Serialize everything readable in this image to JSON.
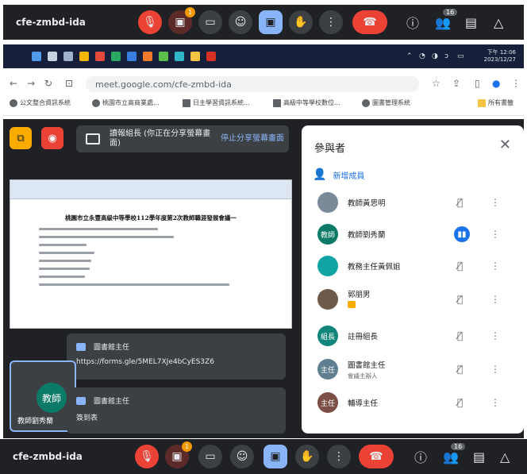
{
  "meeting": {
    "code": "cfe-zmbd-ida",
    "notification_count": "1",
    "people_count": "16"
  },
  "taskbar": {
    "clock_time": "下午 12:06",
    "clock_date": "2023/12/27"
  },
  "browser": {
    "url": "meet.google.com/cfe-zmbd-ida",
    "bookmarks": [
      "公文整合資訊系統",
      "桃園市立高商業處...",
      "日主學習資訊系統...",
      "高級中等學校數位...",
      "圖書管理系統"
    ],
    "all_bookmarks": "所有書籤"
  },
  "presenting": {
    "text": "讀報組長 (你正在分享螢幕畫面)",
    "stop_label": "停止分享螢幕畫面"
  },
  "document": {
    "title": "桃園市立永豐高級中等學校112學年度第2次教師職涯發展會議一"
  },
  "chat": [
    {
      "sender": "圖書館主任",
      "message": "https://forms.gle/5MEL7XJe4bCyES3Z6"
    },
    {
      "sender": "圖書館主任",
      "message": "簽到表"
    }
  ],
  "self_tile": {
    "avatar": "教師",
    "name": "教師劉秀蘭"
  },
  "panel": {
    "title": "參與者",
    "add_label": "新增成員",
    "participants": [
      {
        "avatar": "",
        "name": "教師黃思明",
        "sub": "",
        "color": "#7a8a99",
        "speaking": false,
        "hand": false
      },
      {
        "avatar": "教師",
        "name": "教師劉秀蘭",
        "sub": "",
        "color": "#0b7a67",
        "speaking": true,
        "hand": false
      },
      {
        "avatar": "",
        "name": "教務主任黃佩姐",
        "sub": "",
        "color": "#12a4a3",
        "speaking": false,
        "hand": false
      },
      {
        "avatar": "",
        "name": "郭朋男",
        "sub": "",
        "color": "#6e5a4a",
        "speaking": false,
        "hand": true
      },
      {
        "avatar": "組長",
        "name": "註冊組長",
        "sub": "",
        "color": "#12867a",
        "speaking": false,
        "hand": false
      },
      {
        "avatar": "主任",
        "name": "圖書館主任",
        "sub": "會議主辦人",
        "color": "#5f7f91",
        "speaking": false,
        "hand": false
      },
      {
        "avatar": "主任",
        "name": "輔導主任",
        "sub": "",
        "color": "#7b4f45",
        "speaking": false,
        "hand": false
      }
    ]
  }
}
